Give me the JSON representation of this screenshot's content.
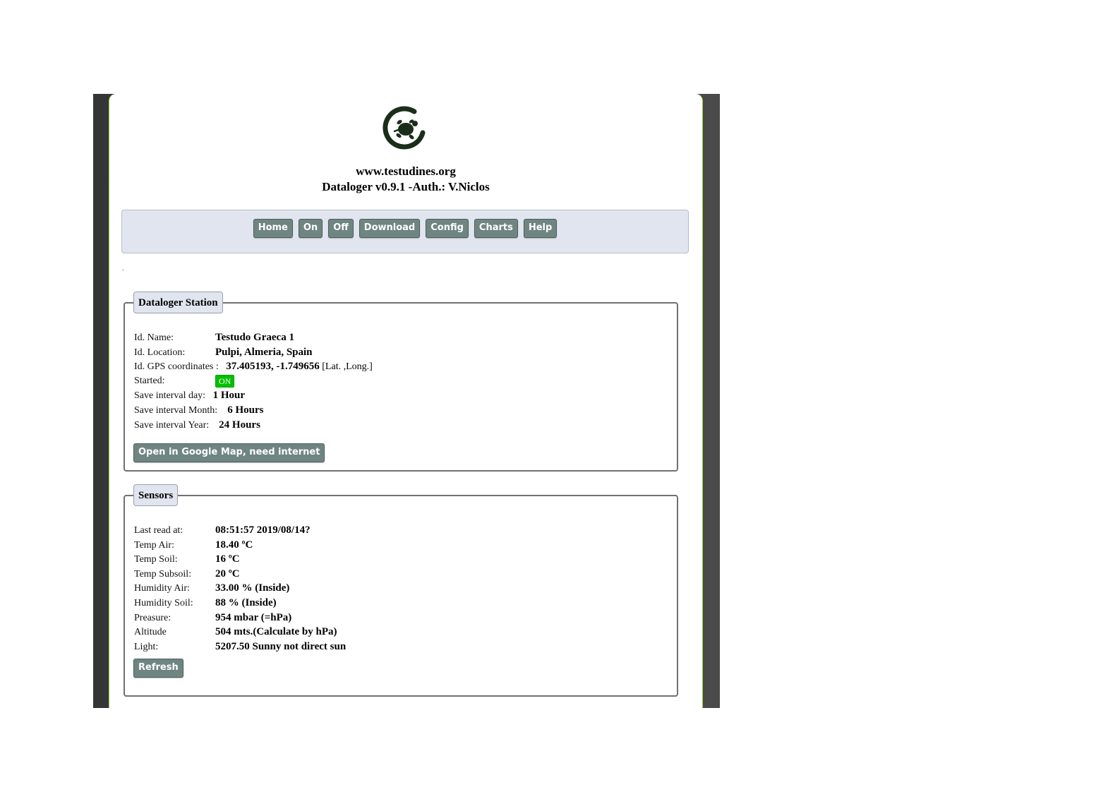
{
  "header": {
    "site": "www.testudines.org",
    "version": "Dataloger v0.9.1 -Auth.: V.Niclos"
  },
  "nav": {
    "buttons": [
      "Home",
      "On",
      "Off",
      "Download",
      "Config",
      "Charts",
      "Help"
    ]
  },
  "dot": ".",
  "station": {
    "legend": "Dataloger Station",
    "rows": {
      "name_label": "Id. Name:",
      "name_value": "Testudo Graeca 1",
      "location_label": "Id. Location:",
      "location_value": "Pulpi, Almeria, Spain",
      "gps_label": "Id. GPS coordinates :",
      "gps_value": "37.405193, -1.749656",
      "gps_suffix": "[Lat. ,Long.]",
      "started_label": "Started:",
      "started_value": "ON",
      "day_label": "Save interval day:",
      "day_value": "1 Hour",
      "month_label": "Save interval Month:",
      "month_value": "6 Hours",
      "year_label": "Save interval Year:",
      "year_value": "24 Hours"
    },
    "map_button": "Open in Google Map, need internet"
  },
  "sensors": {
    "legend": "Sensors",
    "rows": [
      {
        "label": "Last read at:",
        "value": "08:51:57 2019/08/14?"
      },
      {
        "label": "Temp Air:",
        "value": "18.40 ºC"
      },
      {
        "label": "Temp Soil:",
        "value": "16 ºC"
      },
      {
        "label": "Temp Subsoil:",
        "value": "20 ºC"
      },
      {
        "label": "Humidity Air:",
        "value": "33.00 % (Inside)"
      },
      {
        "label": "Humidity Soil:",
        "value": "88 % (Inside)"
      },
      {
        "label": "Preasure:",
        "value": "954 mbar (=hPa)"
      },
      {
        "label": "Altitude",
        "value": "504 mts.(Calculate by hPa)"
      },
      {
        "label": "Light:",
        "value": "5207.50 Sunny not direct sun"
      }
    ],
    "refresh_button": "Refresh"
  },
  "colors": {
    "accent_button": "#6f8581",
    "nav_bg": "#e1e5ef",
    "status_on": "#00c000",
    "frame": "#3d3d3d"
  }
}
